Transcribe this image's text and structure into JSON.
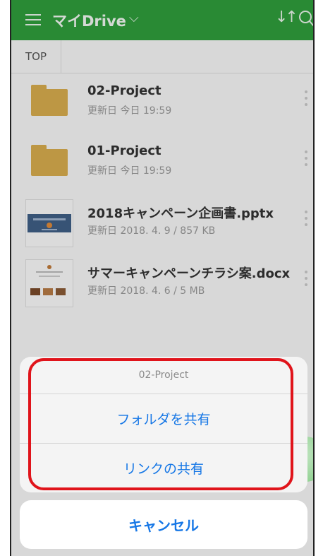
{
  "header": {
    "title": "マイDrive",
    "chevron": "⌵",
    "sort_icon": "sort-icon",
    "search_icon": "search-icon"
  },
  "breadcrumb": {
    "top": "TOP"
  },
  "files": [
    {
      "name": "02-Project",
      "meta": "更新日 今日 19:59",
      "kind": "folder"
    },
    {
      "name": "01-Project",
      "meta": "更新日 今日 19:59",
      "kind": "folder"
    },
    {
      "name": "2018キャンペーン企画書.pptx",
      "meta": "更新日 2018. 4. 9 / 857 KB",
      "kind": "pptx"
    },
    {
      "name": "サマーキャンペーンチラシ案.docx",
      "meta": "更新日 2018. 4. 6 / 5 MB",
      "kind": "docx"
    }
  ],
  "action_sheet": {
    "title": "02-Project",
    "actions": [
      "フォルダを共有",
      "リンクの共有"
    ],
    "cancel": "キャンセル"
  },
  "colors": {
    "header": "#2f9e3c",
    "accent": "#1677e6",
    "folder": "#d8ac4e",
    "highlight": "#e0141b"
  }
}
